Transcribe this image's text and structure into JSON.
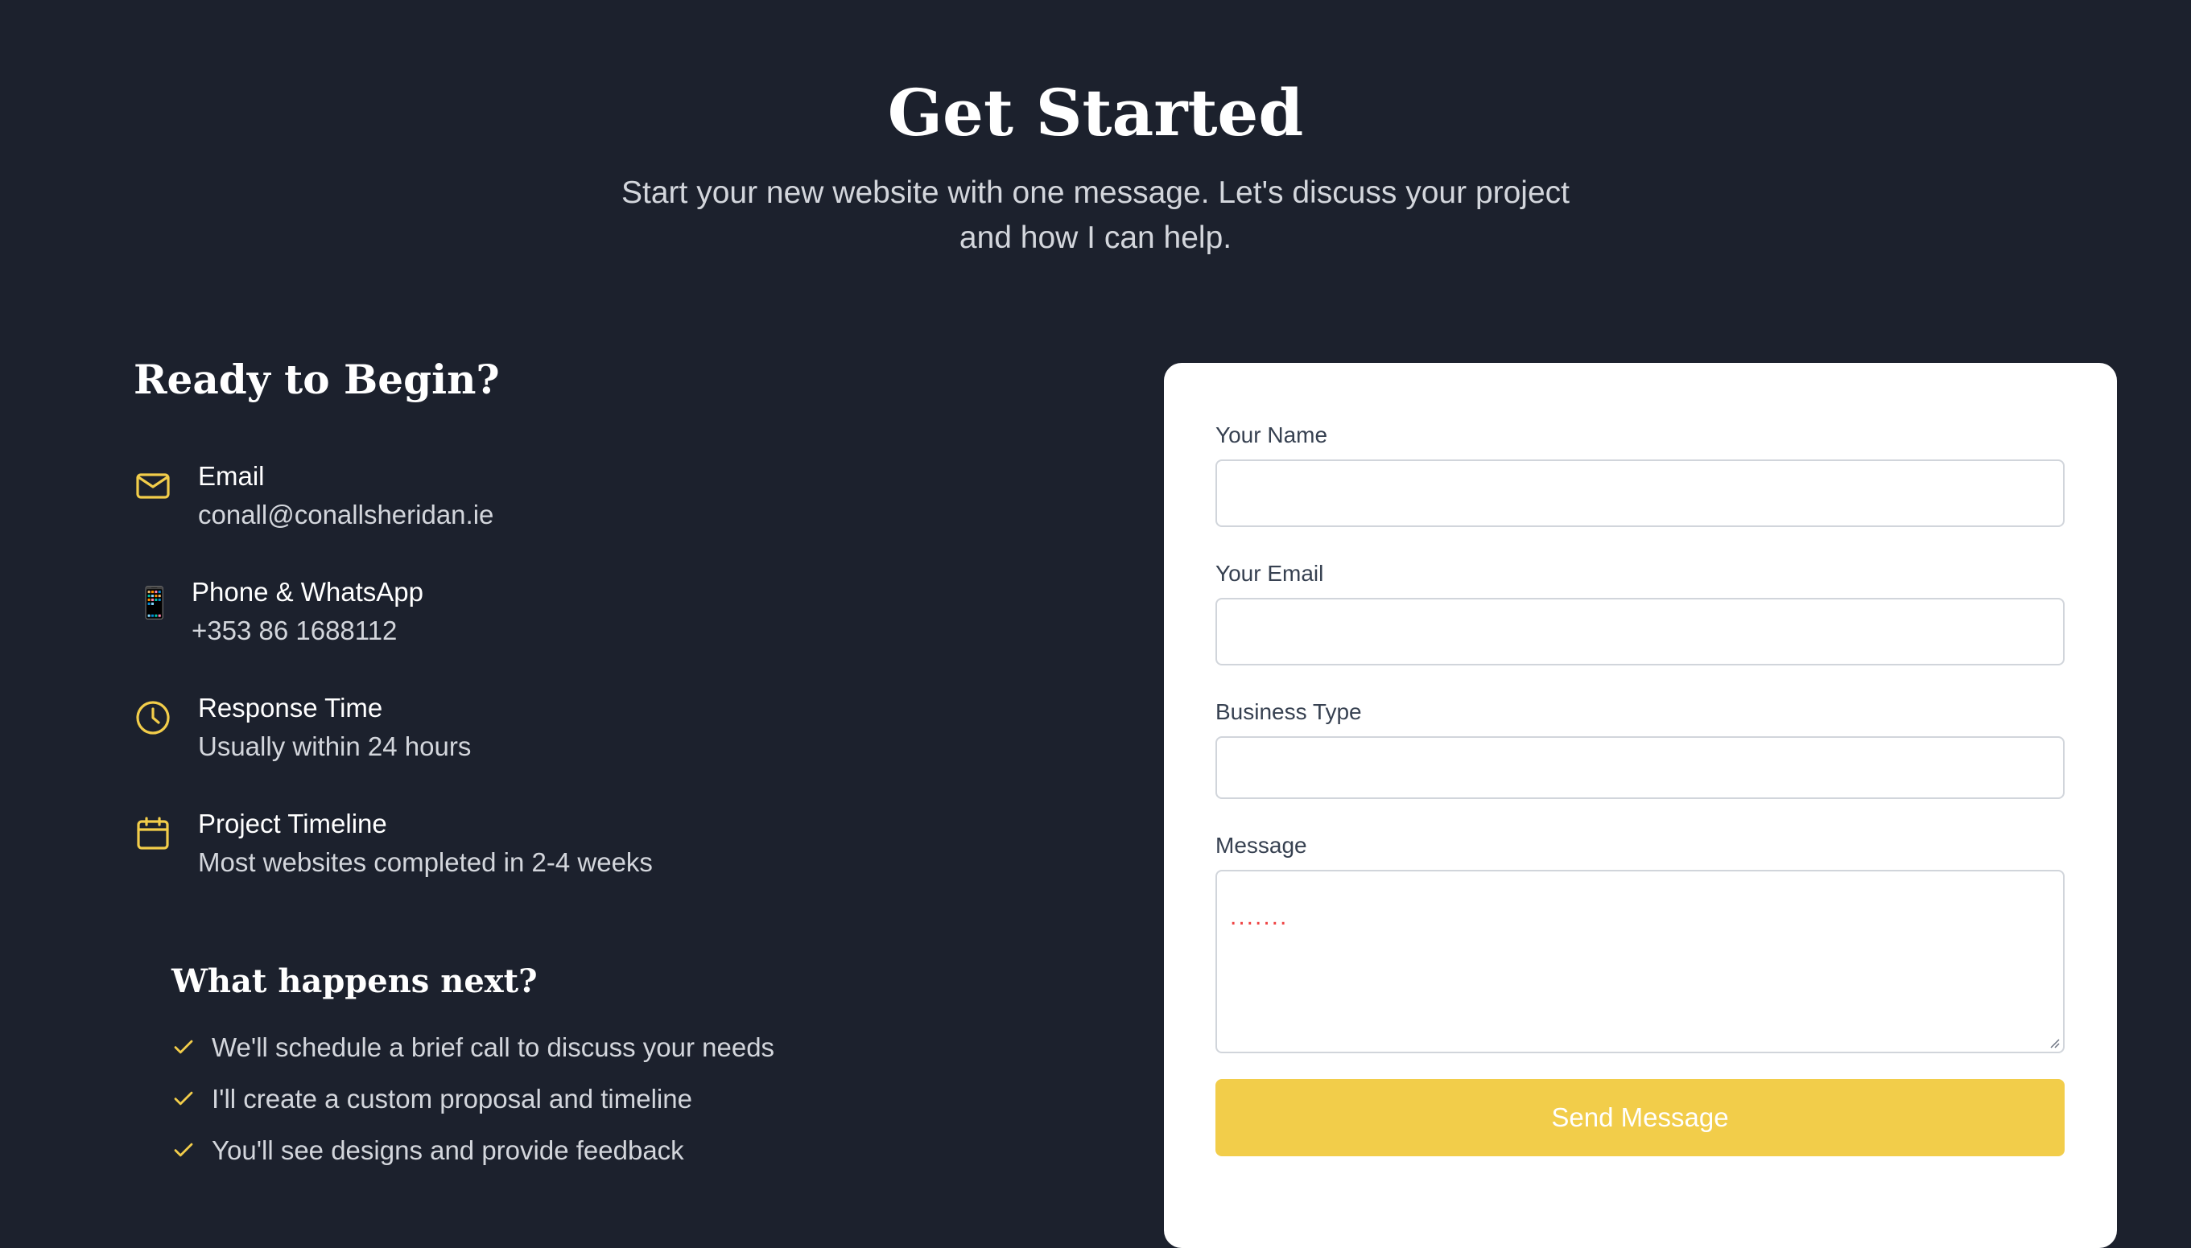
{
  "hero": {
    "title": "Get Started",
    "subtitle": "Start your new website with one message. Let's discuss your project and how I can help."
  },
  "contact": {
    "title": "Ready to Begin?",
    "items": [
      {
        "icon": "mail-icon",
        "label": "Email",
        "value": "conall@conallsheridan.ie"
      },
      {
        "icon": "mobile-phone-icon",
        "glyph": "📱",
        "label": "Phone & WhatsApp",
        "value": "+353 86 1688112"
      },
      {
        "icon": "clock-icon",
        "label": "Response Time",
        "value": "Usually within 24 hours"
      },
      {
        "icon": "calendar-icon",
        "label": "Project Timeline",
        "value": "Most websites completed in 2-4 weeks"
      }
    ]
  },
  "next_steps": {
    "title": "What happens next?",
    "items": [
      "We'll schedule a brief call to discuss your needs",
      "I'll create a custom proposal and timeline",
      "You'll see designs and provide feedback"
    ]
  },
  "form": {
    "name_label": "Your Name",
    "name_value": "",
    "email_label": "Your Email",
    "email_value": "",
    "business_label": "Business Type",
    "business_value": "",
    "message_label": "Message",
    "message_value": "",
    "message_placeholder": ".......",
    "submit_label": "Send Message"
  },
  "colors": {
    "background": "#1c212d",
    "accent": "#f2cd4a",
    "card": "#ffffff"
  }
}
